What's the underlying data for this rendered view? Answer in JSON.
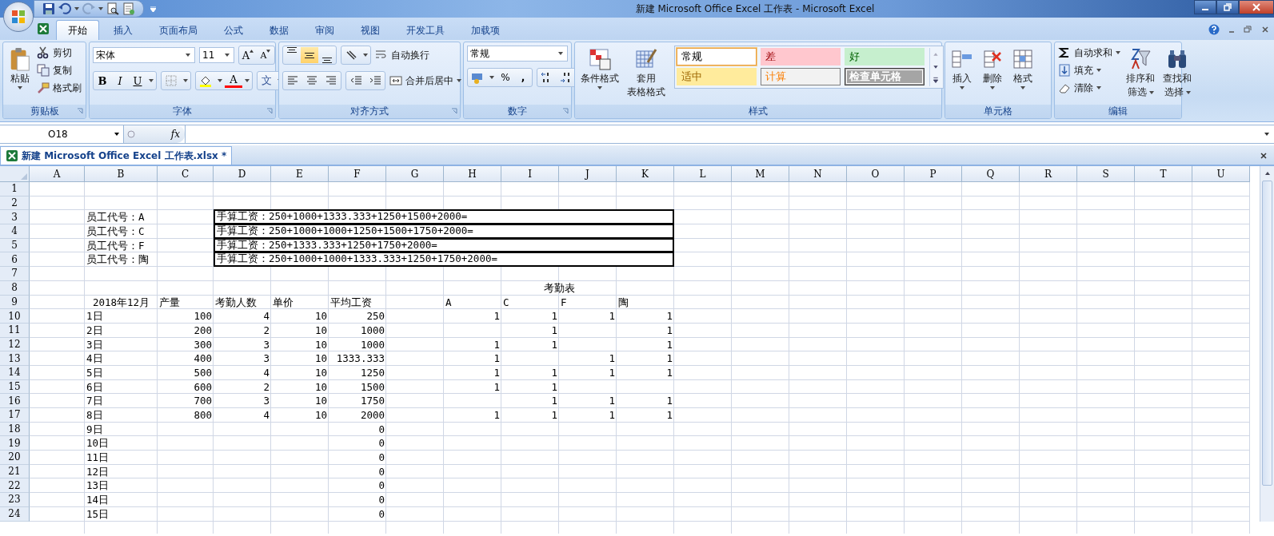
{
  "window": {
    "title": "新建 Microsoft Office Excel 工作表 - Microsoft Excel"
  },
  "ribbon_tabs": [
    {
      "label": "开始",
      "selected": true
    },
    {
      "label": "插入",
      "selected": false
    },
    {
      "label": "页面布局",
      "selected": false
    },
    {
      "label": "公式",
      "selected": false
    },
    {
      "label": "数据",
      "selected": false
    },
    {
      "label": "审阅",
      "selected": false
    },
    {
      "label": "视图",
      "selected": false
    },
    {
      "label": "开发工具",
      "selected": false
    },
    {
      "label": "加载项",
      "selected": false
    }
  ],
  "clipboard": {
    "label": "剪贴板",
    "paste": "粘贴",
    "cut": "剪切",
    "copy": "复制",
    "format_painter": "格式刷"
  },
  "font": {
    "label": "字体",
    "font_name": "宋体",
    "font_size": "11",
    "grow": "A",
    "shrink": "A",
    "bold": "B",
    "italic": "I",
    "underline": "U",
    "font_color": "A",
    "phonetic": "文"
  },
  "alignment": {
    "label": "对齐方式",
    "vertical": [
      {
        "selected": false
      },
      {
        "selected": true
      },
      {
        "selected": false
      }
    ],
    "wrap_text": "自动换行",
    "merge_center": "合并后居中"
  },
  "number": {
    "label": "数字",
    "format": "常规",
    "percent": "%",
    "comma": ","
  },
  "styles": {
    "label": "样式",
    "conditional": [
      "条件格式"
    ],
    "table_format": [
      "套用",
      "表格格式"
    ],
    "cells": [
      {
        "label": "常规",
        "kind": "normal",
        "selected": true
      },
      {
        "label": "差",
        "kind": "bad",
        "selected": false
      },
      {
        "label": "好",
        "kind": "good",
        "selected": false
      },
      {
        "label": "适中",
        "kind": "neutral",
        "selected": false
      },
      {
        "label": "计算",
        "kind": "calculation",
        "selected": false
      },
      {
        "label": "检查单元格",
        "kind": "check",
        "selected": false
      }
    ]
  },
  "cells_group": {
    "label": "单元格",
    "insert": "插入",
    "delete": "删除",
    "format": "格式"
  },
  "editing": {
    "label": "编辑",
    "autosum": "自动求和",
    "fill": "填充",
    "clear": "清除",
    "sort_filter": [
      "排序和",
      "筛选"
    ],
    "find_select": [
      "查找和",
      "选择"
    ]
  },
  "formula_bar": {
    "name_box": "O18",
    "function_label": "fx"
  },
  "document_tab": {
    "title": "新建 Microsoft Office Excel 工作表.xlsx *"
  },
  "sheet": {
    "columns": [
      "A",
      "B",
      "C",
      "D",
      "E",
      "F",
      "G",
      "H",
      "I",
      "J",
      "K",
      "L",
      "M",
      "N",
      "O",
      "P",
      "Q",
      "R",
      "S",
      "T",
      "U"
    ],
    "rows": [
      {
        "number": "1"
      },
      {
        "number": "2"
      },
      {
        "number": "3",
        "B": {
          "text": "员工代号：A",
          "kind": "text"
        },
        "D": {
          "text": "手算工资：250+1000+1333.333+1250+1500+2000=",
          "kind": "boxed"
        }
      },
      {
        "number": "4",
        "B": {
          "text": "员工代号：C",
          "kind": "text"
        },
        "D": {
          "text": "手算工资：250+1000+1000+1250+1500+1750+2000=",
          "kind": "boxed"
        }
      },
      {
        "number": "5",
        "B": {
          "text": "员工代号：F",
          "kind": "text"
        },
        "D": {
          "text": "手算工资：250+1333.333+1250+1750+2000=",
          "kind": "boxed"
        }
      },
      {
        "number": "6",
        "B": {
          "text": "员工代号：陶",
          "kind": "text"
        },
        "D": {
          "text": "手算工资：250+1000+1000+1333.333+1250+1750+2000=",
          "kind": "boxed"
        }
      },
      {
        "number": "7"
      },
      {
        "number": "8",
        "title": {
          "H": {
            "text": "考勤表",
            "kind": "merged"
          }
        }
      },
      {
        "number": "9",
        "headers": {
          "B": {
            "text": "2018年12月",
            "kind": "centered"
          },
          "C": {
            "text": "产量",
            "kind": "text"
          },
          "D": {
            "text": "考勤人数",
            "kind": "text"
          },
          "E": {
            "text": "单价",
            "kind": "text"
          },
          "F": {
            "text": "平均工资",
            "kind": "text"
          },
          "H": {
            "text": "A",
            "kind": "text"
          },
          "I": {
            "text": "C",
            "kind": "text"
          },
          "J": {
            "text": "F",
            "kind": "text"
          },
          "K": {
            "text": "陶",
            "kind": "text"
          }
        }
      },
      {
        "number": "10",
        "B": {
          "text": "1日",
          "kind": "text"
        },
        "C": {
          "text": "100",
          "kind": "number"
        },
        "D": {
          "text": "4",
          "kind": "number"
        },
        "E": {
          "text": "10",
          "kind": "number"
        },
        "F": {
          "text": "250",
          "kind": "number"
        },
        "H": {
          "text": "1",
          "kind": "number"
        },
        "I": {
          "text": "1",
          "kind": "number"
        },
        "J": {
          "text": "1",
          "kind": "number"
        },
        "K": {
          "text": "1",
          "kind": "number"
        }
      },
      {
        "number": "11",
        "B": {
          "text": "2日",
          "kind": "text"
        },
        "C": {
          "text": "200",
          "kind": "number"
        },
        "D": {
          "text": "2",
          "kind": "number"
        },
        "E": {
          "text": "10",
          "kind": "number"
        },
        "F": {
          "text": "1000",
          "kind": "number"
        },
        "I": {
          "text": "1",
          "kind": "number"
        },
        "K": {
          "text": "1",
          "kind": "number"
        }
      },
      {
        "number": "12",
        "B": {
          "text": "3日",
          "kind": "text"
        },
        "C": {
          "text": "300",
          "kind": "number"
        },
        "D": {
          "text": "3",
          "kind": "number"
        },
        "E": {
          "text": "10",
          "kind": "number"
        },
        "F": {
          "text": "1000",
          "kind": "number"
        },
        "H": {
          "text": "1",
          "kind": "number"
        },
        "I": {
          "text": "1",
          "kind": "number"
        },
        "K": {
          "text": "1",
          "kind": "number"
        }
      },
      {
        "number": "13",
        "B": {
          "text": "4日",
          "kind": "text"
        },
        "C": {
          "text": "400",
          "kind": "number"
        },
        "D": {
          "text": "3",
          "kind": "number"
        },
        "E": {
          "text": "10",
          "kind": "number"
        },
        "F": {
          "text": "1333.333",
          "kind": "number"
        },
        "H": {
          "text": "1",
          "kind": "number"
        },
        "J": {
          "text": "1",
          "kind": "number"
        },
        "K": {
          "text": "1",
          "kind": "number"
        }
      },
      {
        "number": "14",
        "B": {
          "text": "5日",
          "kind": "text"
        },
        "C": {
          "text": "500",
          "kind": "number"
        },
        "D": {
          "text": "4",
          "kind": "number"
        },
        "E": {
          "text": "10",
          "kind": "number"
        },
        "F": {
          "text": "1250",
          "kind": "number"
        },
        "H": {
          "text": "1",
          "kind": "number"
        },
        "I": {
          "text": "1",
          "kind": "number"
        },
        "J": {
          "text": "1",
          "kind": "number"
        },
        "K": {
          "text": "1",
          "kind": "number"
        }
      },
      {
        "number": "15",
        "B": {
          "text": "6日",
          "kind": "text"
        },
        "C": {
          "text": "600",
          "kind": "number"
        },
        "D": {
          "text": "2",
          "kind": "number"
        },
        "E": {
          "text": "10",
          "kind": "number"
        },
        "F": {
          "text": "1500",
          "kind": "number"
        },
        "H": {
          "text": "1",
          "kind": "number"
        },
        "I": {
          "text": "1",
          "kind": "number"
        }
      },
      {
        "number": "16",
        "B": {
          "text": "7日",
          "kind": "text"
        },
        "C": {
          "text": "700",
          "kind": "number"
        },
        "D": {
          "text": "3",
          "kind": "number"
        },
        "E": {
          "text": "10",
          "kind": "number"
        },
        "F": {
          "text": "1750",
          "kind": "number"
        },
        "I": {
          "text": "1",
          "kind": "number"
        },
        "J": {
          "text": "1",
          "kind": "number"
        },
        "K": {
          "text": "1",
          "kind": "number"
        }
      },
      {
        "number": "17",
        "B": {
          "text": "8日",
          "kind": "text"
        },
        "C": {
          "text": "800",
          "kind": "number"
        },
        "D": {
          "text": "4",
          "kind": "number"
        },
        "E": {
          "text": "10",
          "kind": "number"
        },
        "F": {
          "text": "2000",
          "kind": "number"
        },
        "H": {
          "text": "1",
          "kind": "number"
        },
        "I": {
          "text": "1",
          "kind": "number"
        },
        "J": {
          "text": "1",
          "kind": "number"
        },
        "K": {
          "text": "1",
          "kind": "number"
        }
      },
      {
        "number": "18",
        "B": {
          "text": "9日",
          "kind": "text"
        },
        "F": {
          "text": "0",
          "kind": "number"
        }
      },
      {
        "number": "19",
        "B": {
          "text": "10日",
          "kind": "text"
        },
        "F": {
          "text": "0",
          "kind": "number"
        }
      },
      {
        "number": "20",
        "B": {
          "text": "11日",
          "kind": "text"
        },
        "F": {
          "text": "0",
          "kind": "number"
        }
      },
      {
        "number": "21",
        "B": {
          "text": "12日",
          "kind": "text"
        },
        "F": {
          "text": "0",
          "kind": "number"
        }
      },
      {
        "number": "22",
        "B": {
          "text": "13日",
          "kind": "text"
        },
        "F": {
          "text": "0",
          "kind": "number"
        }
      },
      {
        "number": "23",
        "B": {
          "text": "14日",
          "kind": "text"
        },
        "F": {
          "text": "0",
          "kind": "number"
        }
      },
      {
        "number": "24",
        "B": {
          "text": "15日",
          "kind": "text"
        },
        "F": {
          "text": "0",
          "kind": "number"
        }
      }
    ]
  }
}
